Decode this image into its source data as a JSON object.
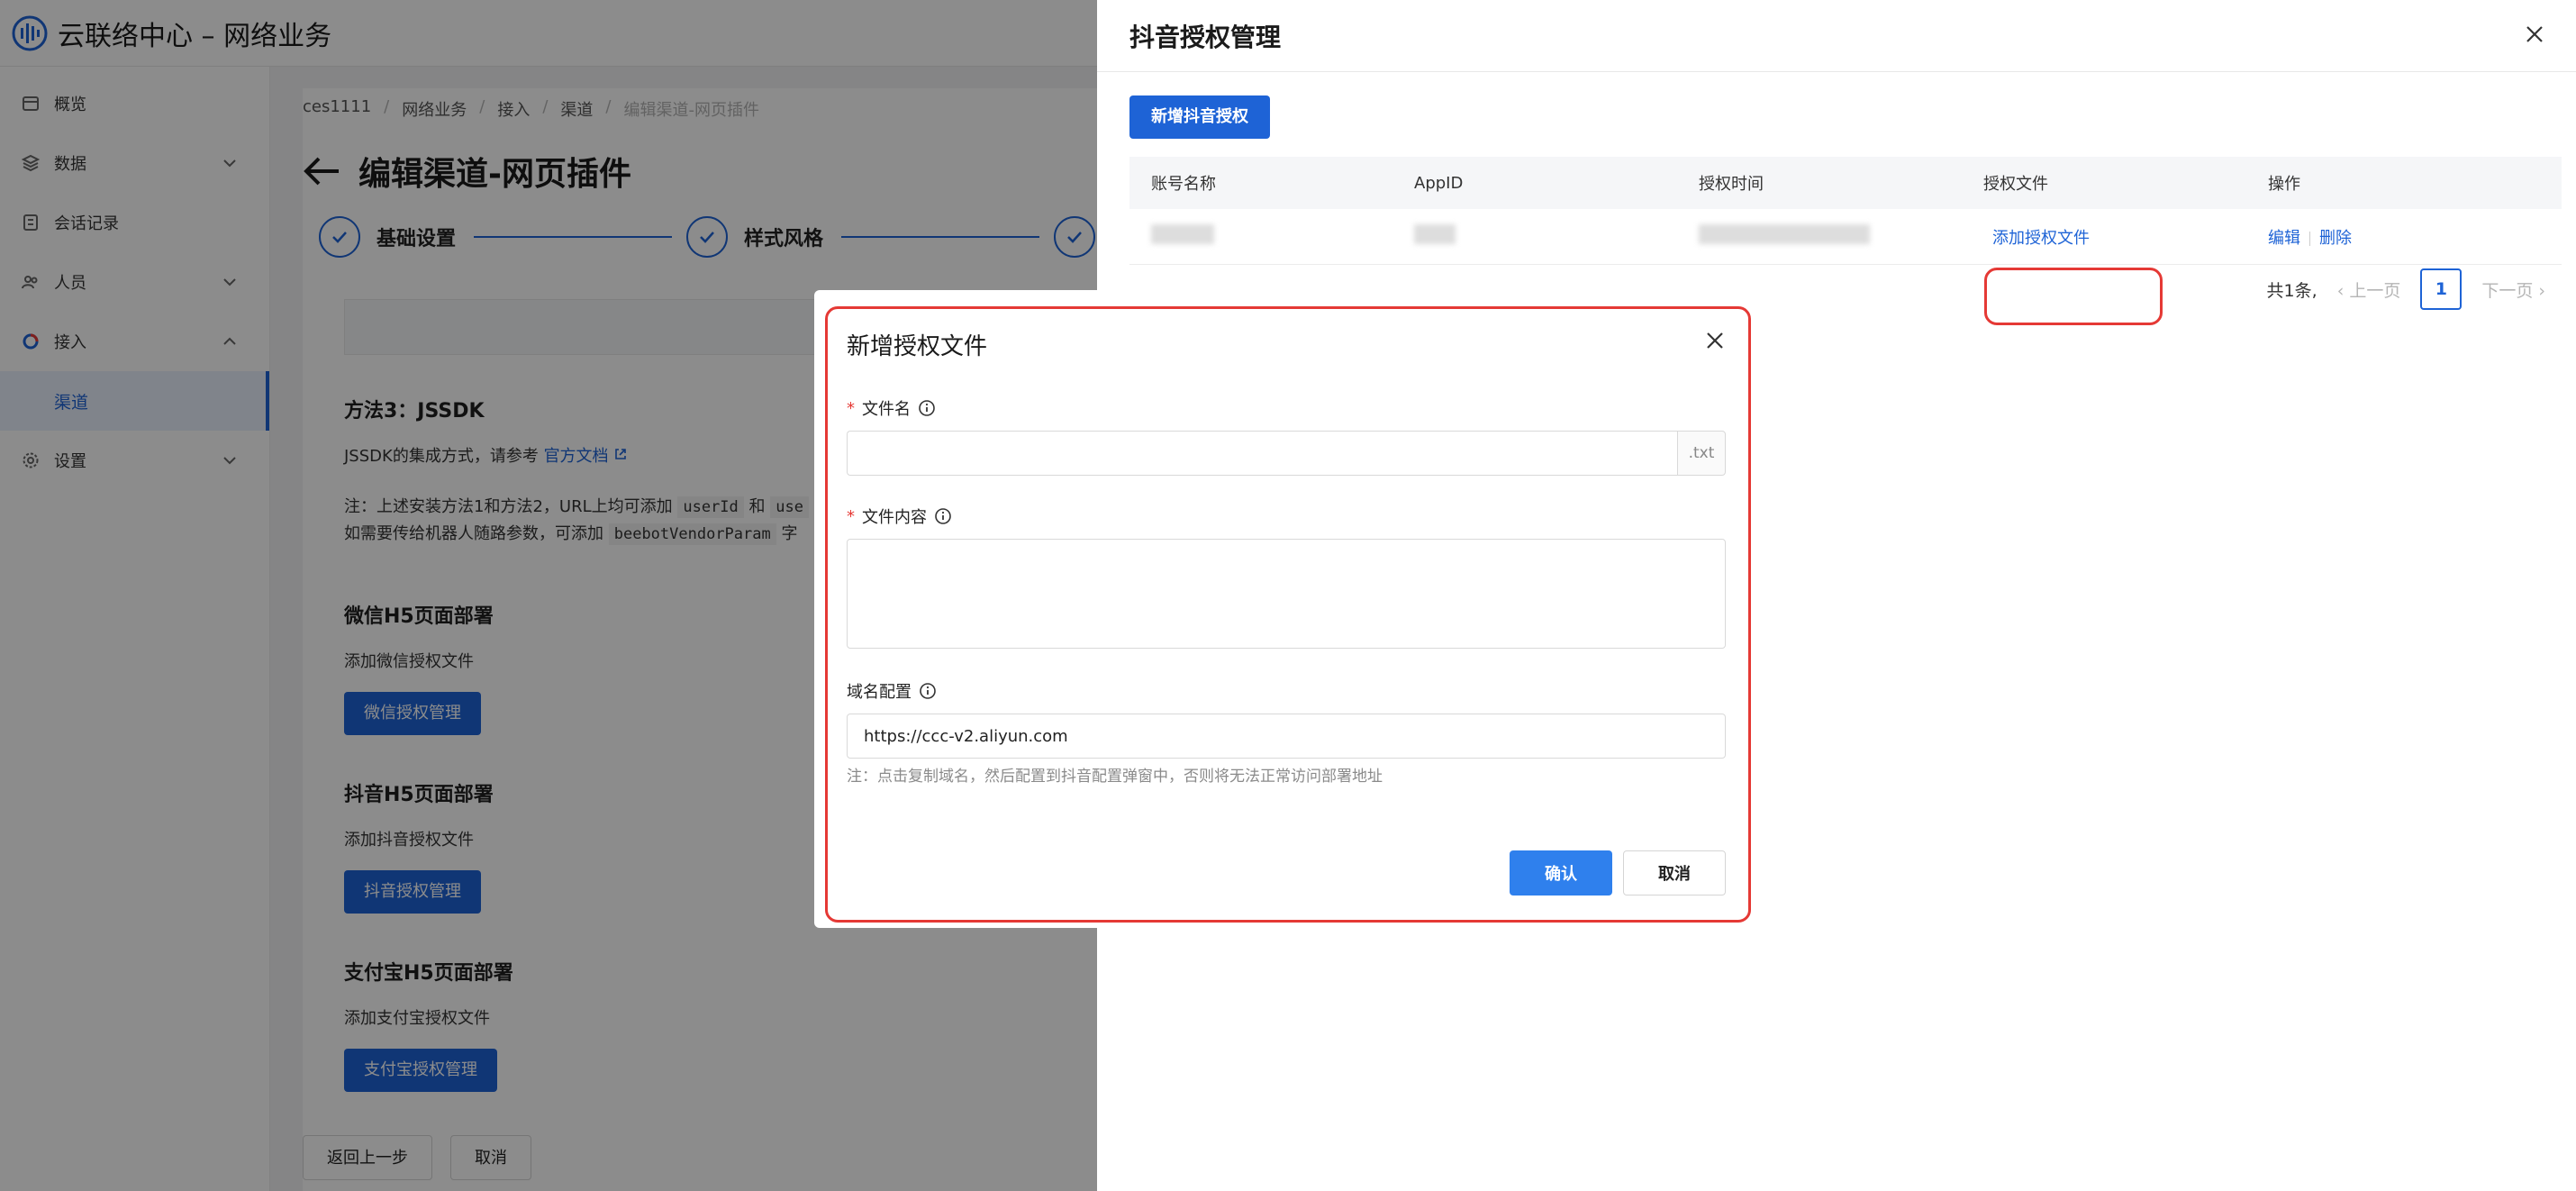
{
  "app": {
    "title": "云联络中心 – 网络业务"
  },
  "sidebar": {
    "items": [
      {
        "label": "概览"
      },
      {
        "label": "数据"
      },
      {
        "label": "会话记录"
      },
      {
        "label": "人员"
      },
      {
        "label": "接入"
      },
      {
        "label": "渠道"
      },
      {
        "label": "设置"
      }
    ]
  },
  "breadcrumb": [
    "ces1111",
    "网络业务",
    "接入",
    "渠道",
    "编辑渠道-网页插件"
  ],
  "page": {
    "title": "编辑渠道-网页插件",
    "steps": [
      "基础设置",
      "样式风格"
    ],
    "method3_title": "方法3：JSSDK",
    "method3_text": "JSSDK的集成方式，请参考",
    "method3_link": "官方文档",
    "note_line1_pre": "注：上述安装方法1和方法2，URL上均可添加",
    "note_code1": "userId",
    "note_and": "和",
    "note_code1b": "use",
    "note_line2_pre": "如需要传给机器人随路参数，可添加",
    "note_code2": "beebotVendorParam",
    "note_line2_post": "字",
    "wechat_title": "微信H5页面部署",
    "wechat_text": "添加微信授权文件",
    "wechat_btn": "微信授权管理",
    "douyin_title": "抖音H5页面部署",
    "douyin_text": "添加抖音授权文件",
    "douyin_btn": "抖音授权管理",
    "alipay_title": "支付宝H5页面部署",
    "alipay_text": "添加支付宝授权文件",
    "alipay_btn": "支付宝授权管理",
    "prev_btn": "返回上一步",
    "cancel_btn": "取消"
  },
  "drawer": {
    "title": "抖音授权管理",
    "add_button": "新增抖音授权",
    "columns": [
      "账号名称",
      "AppID",
      "授权时间",
      "授权文件",
      "操作"
    ],
    "row": {
      "auth_file_link": "添加授权文件",
      "edit": "编辑",
      "delete": "删除"
    },
    "pagination": {
      "total": "共1条,",
      "prev": "上一页",
      "page": "1",
      "next": "下一页"
    }
  },
  "modal": {
    "title": "新增授权文件",
    "filename_label": "文件名",
    "filename_value": "",
    "filename_suffix": ".txt",
    "content_label": "文件内容",
    "content_value": "",
    "domain_label": "域名配置",
    "domain_value": "https://ccc-v2.aliyun.com",
    "note": "注：点击复制域名，然后配置到抖音配置弹窗中，否则将无法正常访问部署地址",
    "confirm": "确认",
    "cancel": "取消"
  },
  "colors": {
    "primary": "#1e63d6",
    "highlight": "#e53935",
    "mask": "rgba(0,0,0,0.45)"
  }
}
